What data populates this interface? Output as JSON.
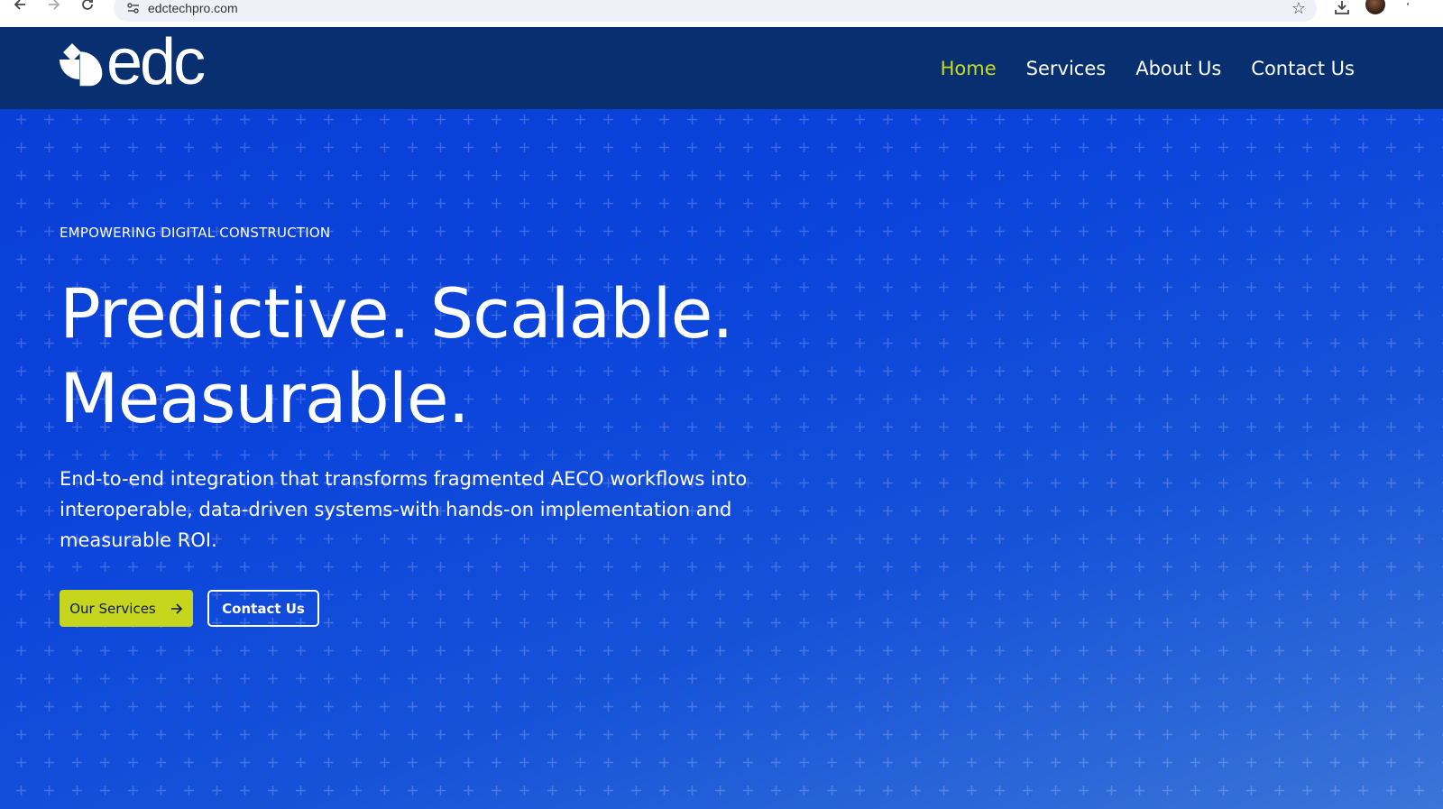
{
  "browser": {
    "url": "edctechpro.com"
  },
  "header": {
    "logo_text": "edc",
    "nav": [
      {
        "label": "Home",
        "active": true
      },
      {
        "label": "Services",
        "active": false
      },
      {
        "label": "About Us",
        "active": false
      },
      {
        "label": "Contact Us",
        "active": false
      }
    ]
  },
  "hero": {
    "eyebrow": "EMPOWERING DIGITAL CONSTRUCTION",
    "headline_line1": "Predictive. Scalable.",
    "headline_line2": "Measurable.",
    "description": "End-to-end integration that transforms fragmented AECO workflows into interoperable, data-driven systems-with hands-on implementation and measurable ROI.",
    "primary_button": "Our Services",
    "secondary_button": "Contact Us"
  },
  "colors": {
    "header_bg": "#083070",
    "hero_bg": "#0a3fd6",
    "accent": "#c5d61d",
    "nav_active": "#c8dc1e"
  },
  "icons": {
    "back": "arrow-left-icon",
    "forward": "arrow-right-icon",
    "reload": "reload-icon",
    "site_info": "tune-icon",
    "bookmark": "star-icon",
    "download": "download-icon",
    "menu": "more-vert-icon",
    "button_arrow": "arrow-right-icon"
  }
}
